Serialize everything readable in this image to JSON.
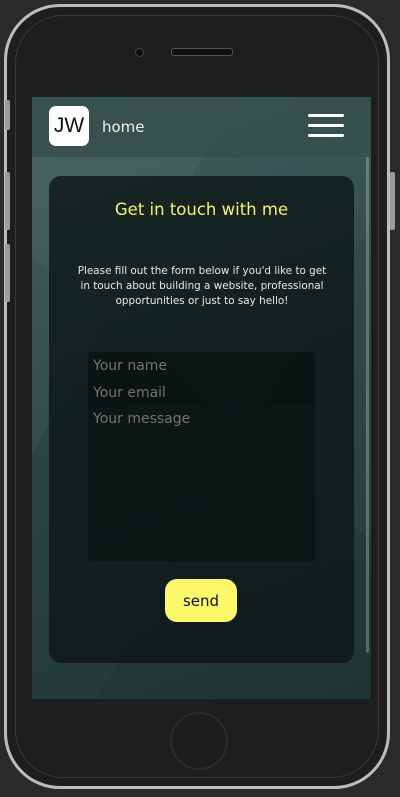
{
  "logo": {
    "text": "JW"
  },
  "nav": {
    "home_label": "home"
  },
  "contact": {
    "title": "Get in touch with me",
    "description": "Please fill out the form below if you'd like to get in touch about building a website, professional opportunities or just to say hello!",
    "name_placeholder": "Your name",
    "email_placeholder": "Your email",
    "message_placeholder": "Your message",
    "send_label": "send"
  },
  "colors": {
    "accent_yellow": "#f7f267",
    "button_yellow": "#fcf86c",
    "background_teal": "#2c4644"
  },
  "icons": {
    "menu": "hamburger-menu-icon"
  }
}
